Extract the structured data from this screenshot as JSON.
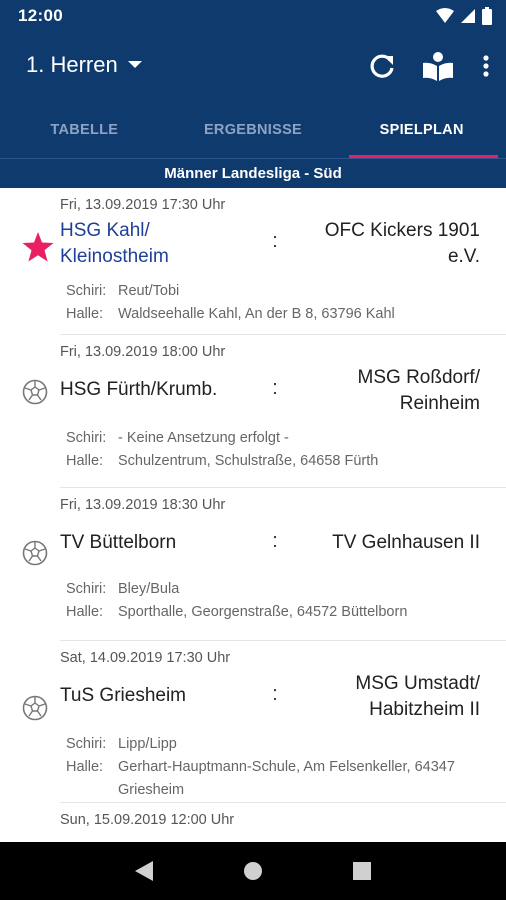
{
  "status_bar": {
    "time": "12:00"
  },
  "app_bar": {
    "team": "1. Herren",
    "icons": [
      "dropdown-arrow-icon",
      "refresh-icon",
      "book-reader-icon",
      "more-vert-icon"
    ]
  },
  "tabs": [
    {
      "label": "TABELLE",
      "active": false
    },
    {
      "label": "ERGEBNISSE",
      "active": false
    },
    {
      "label": "SPIELPLAN",
      "active": true
    }
  ],
  "league": "Männer Landesliga - Süd",
  "labels": {
    "referee": "Schiri:",
    "hall": "Halle:",
    "separator": ":"
  },
  "matches": [
    {
      "date": "Fri, 13.09.2019 17:30 Uhr",
      "home": [
        "HSG Kahl/",
        "Kleinostheim"
      ],
      "away": [
        "OFC Kickers 1901",
        "e.V."
      ],
      "referee": "Reut/Tobi",
      "hall": "Waldseehalle Kahl, An der B 8, 63796 Kahl",
      "icon": "star-icon",
      "favorite": true
    },
    {
      "date": "Fri, 13.09.2019 18:00 Uhr",
      "home": [
        "HSG Fürth/Krumb."
      ],
      "away": [
        "MSG Roßdorf/",
        "Reinheim"
      ],
      "referee": "- Keine Ansetzung erfolgt -",
      "hall": "Schulzentrum, Schulstraße, 64658 Fürth",
      "icon": "ball-icon",
      "favorite": false
    },
    {
      "date": "Fri, 13.09.2019 18:30 Uhr",
      "home": [
        "TV Büttelborn"
      ],
      "away": [
        "TV Gelnhausen II"
      ],
      "referee": "Bley/Bula",
      "hall": "Sporthalle, Georgenstraße, 64572 Büttelborn",
      "icon": "ball-icon",
      "favorite": false
    },
    {
      "date": "Sat, 14.09.2019 17:30 Uhr",
      "home": [
        "TuS Griesheim"
      ],
      "away": [
        "MSG Umstadt/",
        "Habitzheim II"
      ],
      "referee": "Lipp/Lipp",
      "hall": "Gerhart-Hauptmann-Schule, Am Felsenkeller, 64347 Griesheim",
      "icon": "ball-icon",
      "favorite": false
    },
    {
      "date": "Sun, 15.09.2019 12:00 Uhr"
    }
  ],
  "colors": {
    "primary": "#0f3a6e",
    "accent": "#e91e63",
    "favorite_text": "#1f3f98",
    "inactive_tab": "#8ea3c3"
  }
}
